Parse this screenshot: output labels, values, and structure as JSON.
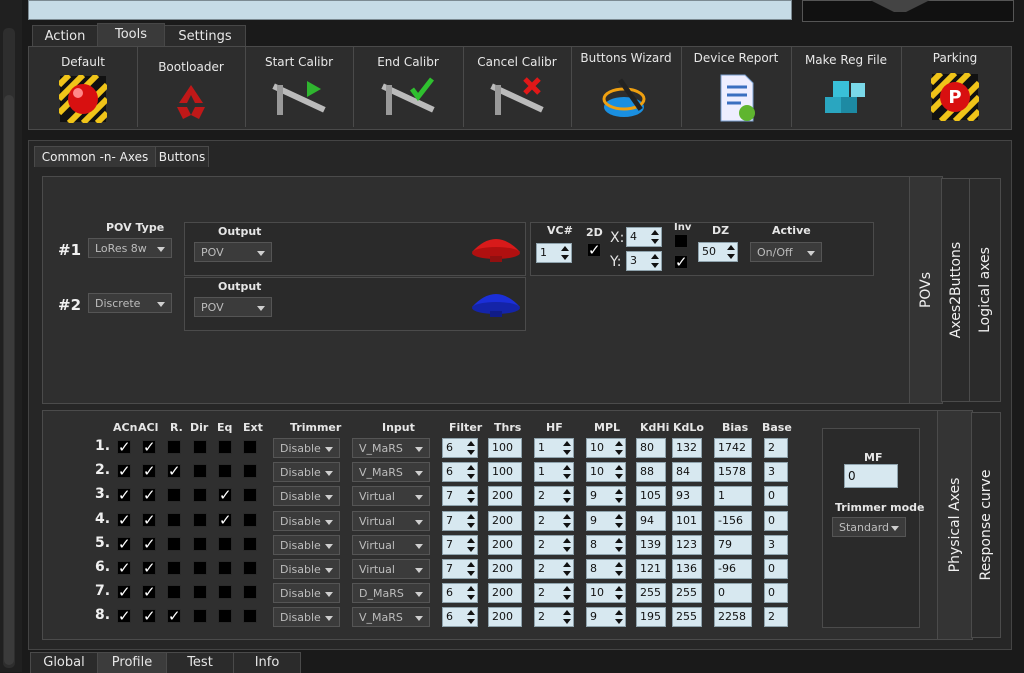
{
  "main_tabs": [
    "Action",
    "Tools",
    "Settings"
  ],
  "toolbar": [
    "Default",
    "Bootloader",
    "Start Calibr",
    "End Calibr",
    "Cancel Calibr",
    "Buttons Wizard",
    "Device Report",
    "Make Reg File",
    "Parking"
  ],
  "sub_tabs": [
    "Common -n- Axes",
    "Buttons"
  ],
  "side_tabs_top": [
    "POVs",
    "Axes2Buttons",
    "Logical axes"
  ],
  "side_tabs_bottom": [
    "Physical Axes",
    "Response curve"
  ],
  "pov": {
    "pov_type_label": "POV Type",
    "output_label": "Output",
    "rows": [
      {
        "num": "#1",
        "type": "LoRes 8w",
        "output": "POV",
        "hat_color": "#d81a1a"
      },
      {
        "num": "#2",
        "type": "Discrete",
        "output": "POV",
        "hat_color": "#1b2fd8"
      }
    ],
    "vc_label": "VC#",
    "vc_value": "1",
    "twod_label": "2D",
    "x_label": "X:",
    "x_value": "4",
    "y_label": "Y:",
    "y_value": "3",
    "inv_label": "Inv",
    "dz_label": "DZ",
    "dz_value": "50",
    "active_label": "Active",
    "active_value": "On/Off"
  },
  "axes": {
    "headers": {
      "acn": "ACn",
      "acl": "ACl",
      "r": "R.",
      "dir": "Dir",
      "eq": "Eq",
      "ext": "Ext",
      "trimmer": "Trimmer",
      "input": "Input",
      "filter": "Filter",
      "thrs": "Thrs",
      "hf": "HF",
      "mpl": "MPL",
      "kdhi": "KdHi",
      "kdlo": "KdLo",
      "bias": "Bias",
      "base": "Base"
    },
    "rows": [
      {
        "num": "1.",
        "acn": true,
        "acl": true,
        "r": false,
        "dir": false,
        "eq": false,
        "ext": false,
        "trimmer": "Disable",
        "input": "V_MaRS",
        "filter": "6",
        "thrs": "100",
        "hf": "1",
        "mpl": "10",
        "kdhi": "80",
        "kdlo": "132",
        "bias": "1742",
        "base": "2"
      },
      {
        "num": "2.",
        "acn": true,
        "acl": true,
        "r": true,
        "dir": false,
        "eq": false,
        "ext": false,
        "trimmer": "Disable",
        "input": "V_MaRS",
        "filter": "6",
        "thrs": "100",
        "hf": "1",
        "mpl": "10",
        "kdhi": "88",
        "kdlo": "84",
        "bias": "1578",
        "base": "3"
      },
      {
        "num": "3.",
        "acn": true,
        "acl": true,
        "r": false,
        "dir": false,
        "eq": true,
        "ext": false,
        "trimmer": "Disable",
        "input": "Virtual",
        "filter": "7",
        "thrs": "200",
        "hf": "2",
        "mpl": "9",
        "kdhi": "105",
        "kdlo": "93",
        "bias": "1",
        "base": "0"
      },
      {
        "num": "4.",
        "acn": true,
        "acl": true,
        "r": false,
        "dir": false,
        "eq": true,
        "ext": false,
        "trimmer": "Disable",
        "input": "Virtual",
        "filter": "7",
        "thrs": "200",
        "hf": "2",
        "mpl": "9",
        "kdhi": "94",
        "kdlo": "101",
        "bias": "-156",
        "base": "0"
      },
      {
        "num": "5.",
        "acn": true,
        "acl": true,
        "r": false,
        "dir": false,
        "eq": false,
        "ext": false,
        "trimmer": "Disable",
        "input": "Virtual",
        "filter": "7",
        "thrs": "200",
        "hf": "2",
        "mpl": "8",
        "kdhi": "139",
        "kdlo": "123",
        "bias": "79",
        "base": "3"
      },
      {
        "num": "6.",
        "acn": true,
        "acl": true,
        "r": false,
        "dir": false,
        "eq": false,
        "ext": false,
        "trimmer": "Disable",
        "input": "Virtual",
        "filter": "7",
        "thrs": "200",
        "hf": "2",
        "mpl": "8",
        "kdhi": "121",
        "kdlo": "136",
        "bias": "-96",
        "base": "0"
      },
      {
        "num": "7.",
        "acn": true,
        "acl": true,
        "r": false,
        "dir": false,
        "eq": false,
        "ext": false,
        "trimmer": "Disable",
        "input": "D_MaRS",
        "filter": "6",
        "thrs": "200",
        "hf": "2",
        "mpl": "10",
        "kdhi": "255",
        "kdlo": "255",
        "bias": "0",
        "base": "0"
      },
      {
        "num": "8.",
        "acn": true,
        "acl": true,
        "r": true,
        "dir": false,
        "eq": false,
        "ext": false,
        "trimmer": "Disable",
        "input": "V_MaRS",
        "filter": "6",
        "thrs": "200",
        "hf": "2",
        "mpl": "9",
        "kdhi": "195",
        "kdlo": "255",
        "bias": "2258",
        "base": "2"
      }
    ]
  },
  "mf": {
    "label": "MF",
    "value": "0",
    "trimmer_mode_label": "Trimmer mode",
    "trimmer_mode_value": "Standard"
  },
  "bottom_tabs": [
    "Global",
    "Profile",
    "Test",
    "Info"
  ]
}
